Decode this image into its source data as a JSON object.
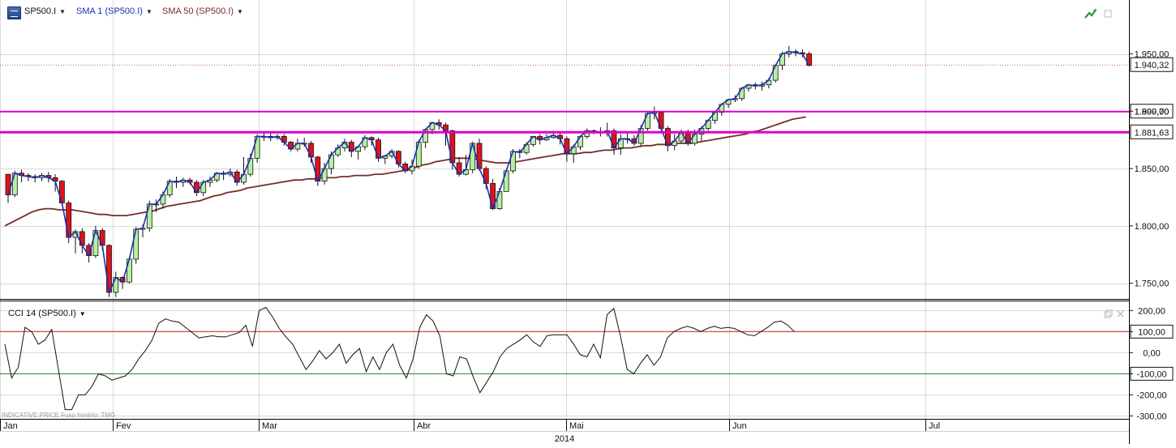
{
  "header": {
    "symbol": "SP500.I",
    "sma1_label": "SMA 1 (SP500.I)",
    "sma50_label": "SMA 50 (SP500.I)",
    "cci_label": "CCI 14 (SP500.I)",
    "indicative": "INDICATIVE PRICE   Fuso horário: TMG"
  },
  "icons": [
    "logo-icon",
    "trend-up-icon",
    "maximize-icon",
    "restore-icon",
    "close-icon",
    "dropdown-arrow-icon"
  ],
  "colors": {
    "up_candle": "#b6f0a0",
    "down_candle": "#e0121a",
    "sma1": "#1a2fb0",
    "sma50": "#7a2a2a",
    "level_line": "#e000c8",
    "cci_line": "#111111",
    "cci_upper": "#cc2222",
    "cci_lower": "#228822",
    "grid": "#d8d8d8"
  },
  "chart_data": {
    "type": "candlestick",
    "year_label": "2014",
    "x_labels": [
      "Jan",
      "Fev",
      "Mar",
      "Abr",
      "Mai",
      "Jun",
      "Jul"
    ],
    "y_ticks": [
      "1.950,00",
      "1.900,00",
      "1.850,00",
      "1.800,00",
      "1.750,00"
    ],
    "y_range": [
      1737,
      1997
    ],
    "current_price": {
      "value": 1940.32,
      "label": "1.940,32"
    },
    "levels": [
      {
        "value": 1899.7,
        "label": "1.899,70"
      },
      {
        "value": 1881.63,
        "label": "1.881,63"
      }
    ],
    "candles": [
      [
        1845,
        1827,
        1842,
        1820
      ],
      [
        1827,
        1846,
        1848,
        1825
      ],
      [
        1846,
        1844,
        1849,
        1838
      ],
      [
        1844,
        1843,
        1846,
        1839
      ],
      [
        1843,
        1842,
        1845,
        1838
      ],
      [
        1842,
        1844,
        1846,
        1839
      ],
      [
        1844,
        1842,
        1847,
        1838
      ],
      [
        1842,
        1839,
        1845,
        1830
      ],
      [
        1839,
        1820,
        1840,
        1818
      ],
      [
        1820,
        1790,
        1822,
        1785
      ],
      [
        1790,
        1795,
        1797,
        1776
      ],
      [
        1795,
        1783,
        1798,
        1776
      ],
      [
        1783,
        1774,
        1785,
        1768
      ],
      [
        1774,
        1796,
        1800,
        1772
      ],
      [
        1796,
        1783,
        1798,
        1779
      ],
      [
        1783,
        1742,
        1784,
        1738
      ],
      [
        1742,
        1755,
        1760,
        1738
      ],
      [
        1755,
        1751,
        1756,
        1745
      ],
      [
        1751,
        1771,
        1773,
        1750
      ],
      [
        1771,
        1797,
        1799,
        1767
      ],
      [
        1797,
        1798,
        1801,
        1790
      ],
      [
        1798,
        1819,
        1822,
        1795
      ],
      [
        1819,
        1819,
        1823,
        1812
      ],
      [
        1819,
        1827,
        1830,
        1815
      ],
      [
        1827,
        1839,
        1841,
        1825
      ],
      [
        1839,
        1838,
        1843,
        1833
      ],
      [
        1838,
        1840,
        1842,
        1834
      ],
      [
        1840,
        1838,
        1842,
        1836
      ],
      [
        1838,
        1829,
        1840,
        1826
      ],
      [
        1829,
        1838,
        1840,
        1826
      ],
      [
        1838,
        1840,
        1843,
        1834
      ],
      [
        1840,
        1846,
        1847,
        1838
      ],
      [
        1846,
        1845,
        1848,
        1840
      ],
      [
        1845,
        1847,
        1850,
        1843
      ],
      [
        1847,
        1838,
        1849,
        1835
      ],
      [
        1838,
        1845,
        1860,
        1836
      ],
      [
        1845,
        1859,
        1863,
        1843
      ],
      [
        1859,
        1878,
        1880,
        1855
      ],
      [
        1878,
        1878,
        1882,
        1874
      ],
      [
        1878,
        1877,
        1881,
        1874
      ],
      [
        1877,
        1878,
        1880,
        1875
      ],
      [
        1878,
        1873,
        1880,
        1870
      ],
      [
        1873,
        1867,
        1874,
        1865
      ],
      [
        1867,
        1872,
        1876,
        1865
      ],
      [
        1872,
        1872,
        1877,
        1869
      ],
      [
        1872,
        1860,
        1874,
        1855
      ],
      [
        1860,
        1839,
        1861,
        1835
      ],
      [
        1839,
        1850,
        1855,
        1836
      ],
      [
        1850,
        1862,
        1865,
        1845
      ],
      [
        1862,
        1868,
        1871,
        1860
      ],
      [
        1868,
        1873,
        1876,
        1865
      ],
      [
        1873,
        1865,
        1875,
        1860
      ],
      [
        1865,
        1869,
        1870,
        1858
      ],
      [
        1869,
        1877,
        1879,
        1866
      ],
      [
        1877,
        1875,
        1878,
        1870
      ],
      [
        1875,
        1859,
        1877,
        1856
      ],
      [
        1859,
        1861,
        1862,
        1854
      ],
      [
        1861,
        1865,
        1867,
        1859
      ],
      [
        1865,
        1854,
        1866,
        1851
      ],
      [
        1854,
        1848,
        1856,
        1846
      ],
      [
        1848,
        1852,
        1858,
        1845
      ],
      [
        1852,
        1873,
        1875,
        1850
      ],
      [
        1873,
        1884,
        1885,
        1868
      ],
      [
        1884,
        1890,
        1891,
        1880
      ],
      [
        1890,
        1888,
        1893,
        1884
      ],
      [
        1888,
        1883,
        1890,
        1870
      ],
      [
        1883,
        1855,
        1884,
        1849
      ],
      [
        1855,
        1845,
        1860,
        1843
      ],
      [
        1845,
        1849,
        1862,
        1844
      ],
      [
        1849,
        1872,
        1872,
        1846
      ],
      [
        1872,
        1850,
        1876,
        1848
      ],
      [
        1850,
        1837,
        1852,
        1832
      ],
      [
        1837,
        1815,
        1841,
        1814
      ],
      [
        1815,
        1830,
        1833,
        1814
      ],
      [
        1830,
        1848,
        1849,
        1830
      ],
      [
        1848,
        1865,
        1867,
        1846
      ],
      [
        1865,
        1864,
        1867,
        1859
      ],
      [
        1864,
        1871,
        1873,
        1862
      ],
      [
        1871,
        1878,
        1878,
        1869
      ],
      [
        1878,
        1875,
        1880,
        1871
      ],
      [
        1875,
        1877,
        1880,
        1874
      ],
      [
        1877,
        1879,
        1883,
        1876
      ],
      [
        1879,
        1876,
        1882,
        1871
      ],
      [
        1876,
        1863,
        1878,
        1856
      ],
      [
        1863,
        1869,
        1871,
        1855
      ],
      [
        1869,
        1878,
        1879,
        1866
      ],
      [
        1878,
        1883,
        1885,
        1876
      ],
      [
        1883,
        1882,
        1884,
        1880
      ],
      [
        1882,
        1881,
        1886,
        1878
      ],
      [
        1881,
        1883,
        1890,
        1878
      ],
      [
        1883,
        1868,
        1885,
        1862
      ],
      [
        1868,
        1876,
        1880,
        1862
      ],
      [
        1876,
        1876,
        1882,
        1872
      ],
      [
        1876,
        1872,
        1879,
        1870
      ],
      [
        1872,
        1885,
        1888,
        1869
      ],
      [
        1885,
        1898,
        1900,
        1883
      ],
      [
        1898,
        1899,
        1904,
        1893
      ],
      [
        1899,
        1885,
        1900,
        1883
      ],
      [
        1885,
        1870,
        1887,
        1865
      ],
      [
        1870,
        1874,
        1880,
        1866
      ],
      [
        1874,
        1882,
        1884,
        1872
      ],
      [
        1882,
        1872,
        1884,
        1870
      ],
      [
        1872,
        1880,
        1884,
        1870
      ],
      [
        1880,
        1885,
        1887,
        1874
      ],
      [
        1885,
        1892,
        1893,
        1883
      ],
      [
        1892,
        1899,
        1900,
        1889
      ],
      [
        1899,
        1906,
        1907,
        1896
      ],
      [
        1906,
        1910,
        1911,
        1903
      ],
      [
        1910,
        1911,
        1914,
        1908
      ],
      [
        1911,
        1920,
        1921,
        1909
      ],
      [
        1920,
        1923,
        1924,
        1917
      ],
      [
        1923,
        1922,
        1925,
        1919
      ],
      [
        1922,
        1923,
        1926,
        1918
      ],
      [
        1923,
        1927,
        1929,
        1920
      ],
      [
        1927,
        1940,
        1941,
        1925
      ],
      [
        1940,
        1950,
        1952,
        1936
      ],
      [
        1950,
        1952,
        1957,
        1947
      ],
      [
        1952,
        1951,
        1954,
        1948
      ],
      [
        1951,
        1950,
        1954,
        1947
      ],
      [
        1950,
        1940,
        1952,
        1939
      ]
    ],
    "sma50": [
      1800,
      1803,
      1806,
      1809,
      1812,
      1814,
      1815,
      1815,
      1814,
      1814,
      1814,
      1813,
      1812,
      1811,
      1810,
      1810,
      1809,
      1809,
      1809,
      1810,
      1811,
      1812,
      1813,
      1815,
      1817,
      1818,
      1819,
      1820,
      1821,
      1822,
      1824,
      1826,
      1827,
      1829,
      1830,
      1831,
      1833,
      1834,
      1835,
      1836,
      1837,
      1838,
      1839,
      1840,
      1840,
      1841,
      1841,
      1842,
      1842,
      1842,
      1843,
      1843,
      1844,
      1844,
      1844,
      1845,
      1845,
      1846,
      1847,
      1848,
      1849,
      1851,
      1853,
      1854,
      1856,
      1857,
      1858,
      1859,
      1859,
      1859,
      1858,
      1857,
      1856,
      1855,
      1855,
      1855,
      1856,
      1857,
      1858,
      1859,
      1860,
      1861,
      1862,
      1863,
      1863,
      1863,
      1864,
      1864,
      1865,
      1866,
      1866,
      1867,
      1868,
      1868,
      1869,
      1870,
      1870,
      1871,
      1871,
      1871,
      1872,
      1872,
      1872,
      1873,
      1874,
      1875,
      1876,
      1877,
      1878,
      1879,
      1880,
      1882,
      1883,
      1885,
      1887,
      1889,
      1891,
      1893,
      1894,
      1895
    ],
    "cci_y_ticks": [
      "200,00",
      "100,00",
      "0,00",
      "-100,00",
      "-200,00",
      "-300,00"
    ],
    "cci_range": [
      -310,
      228
    ],
    "cci_levels": [
      {
        "value": 100,
        "label": "100,00"
      },
      {
        "value": -100,
        "label": "-100,00"
      }
    ],
    "cci": [
      40,
      -120,
      -70,
      120,
      100,
      40,
      60,
      110,
      -80,
      -270,
      -270,
      -200,
      -200,
      -160,
      -100,
      -110,
      -130,
      -120,
      -110,
      -80,
      -30,
      10,
      60,
      140,
      160,
      150,
      145,
      120,
      95,
      70,
      75,
      80,
      75,
      75,
      85,
      95,
      130,
      30,
      200,
      215,
      170,
      115,
      75,
      40,
      -20,
      -80,
      -40,
      10,
      -30,
      0,
      40,
      -50,
      -10,
      20,
      -90,
      -20,
      -80,
      0,
      40,
      -60,
      -120,
      -30,
      120,
      180,
      150,
      80,
      -100,
      -110,
      -20,
      -30,
      -115,
      -190,
      -140,
      -90,
      -20,
      20,
      40,
      60,
      85,
      50,
      30,
      80,
      85,
      85,
      85,
      40,
      -10,
      -20,
      40,
      -25,
      180,
      210,
      80,
      -80,
      -100,
      -50,
      -10,
      -60,
      -20,
      70,
      100,
      115,
      125,
      115,
      100,
      115,
      125,
      115,
      120,
      115,
      100,
      85,
      80,
      100,
      120,
      145,
      150,
      130,
      100
    ]
  }
}
